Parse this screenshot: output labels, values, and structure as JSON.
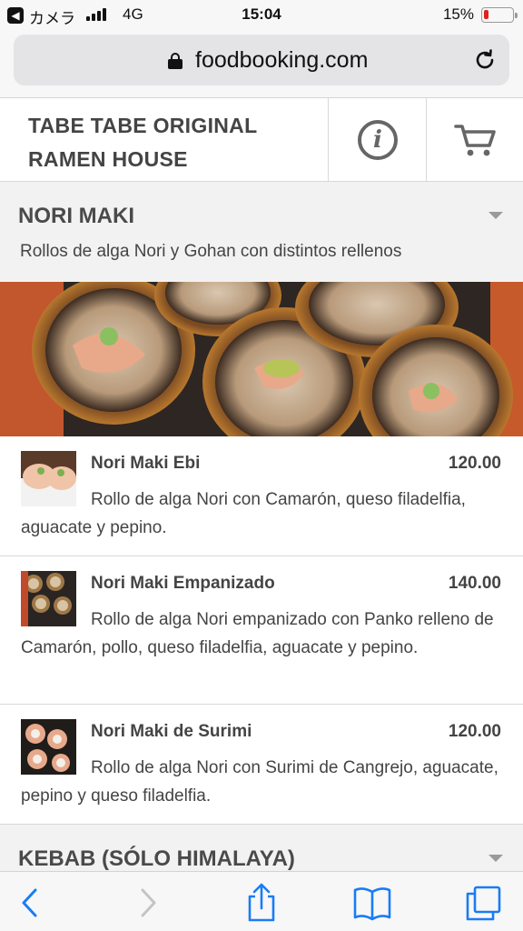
{
  "status_bar": {
    "back_app": "カメラ",
    "network": "4G",
    "time": "15:04",
    "battery": "15%",
    "battery_level": 0.15,
    "battery_color": "#e02020"
  },
  "browser": {
    "url": "foodbooking.com",
    "lock_icon": "lock-icon",
    "reload_icon": "reload-icon"
  },
  "header": {
    "restaurant_line1": "TABE TABE ORIGINAL",
    "restaurant_line2": "RAMEN HOUSE",
    "info_icon": "info-icon",
    "cart_icon": "cart-icon"
  },
  "category": {
    "title": "NORI MAKI",
    "description": "Rollos de alga Nori y Gohan con distintos rellenos"
  },
  "items": [
    {
      "name": "Nori Maki Ebi",
      "price": "120.00",
      "description": "Rollo de alga Nori con Camarón, queso filadelfia, aguacate y pepino."
    },
    {
      "name": "Nori Maki Empanizado",
      "price": "140.00",
      "description": "Rollo de alga Nori empanizado con Panko relleno de Camarón, pollo, queso filadelfia, aguacate y pepino."
    },
    {
      "name": "Nori Maki de Surimi",
      "price": "120.00",
      "description": "Rollo de alga Nori con Surimi de Cangrejo, aguacate, pepino y queso filadelfia."
    }
  ],
  "next_category": {
    "title": "KEBAB (SÓLO HIMALAYA)"
  },
  "toolbar": {
    "accent": "#1a7cf5",
    "disabled": "#c4c4c4"
  }
}
